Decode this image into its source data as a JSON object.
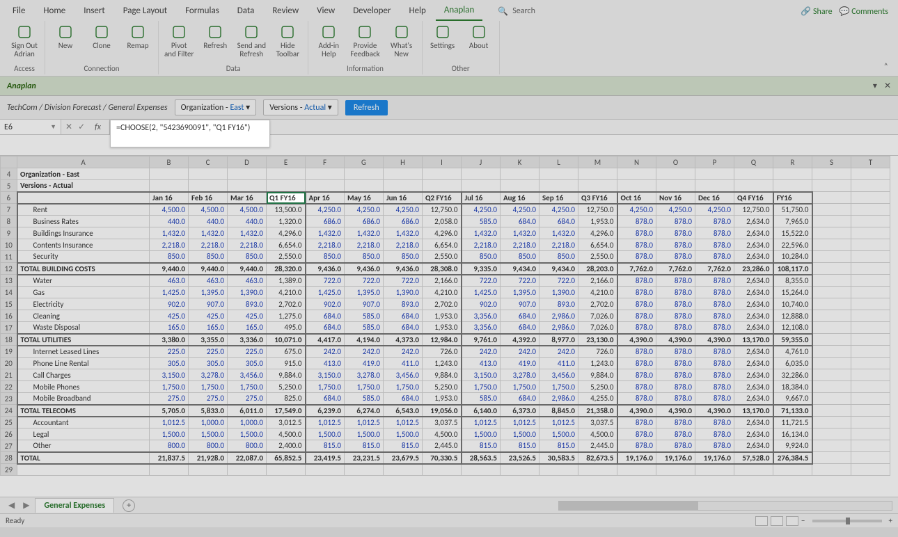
{
  "menu": {
    "items": [
      "File",
      "Home",
      "Insert",
      "Page Layout",
      "Formulas",
      "Data",
      "Review",
      "View",
      "Developer",
      "Help",
      "Anaplan"
    ],
    "active": "Anaplan",
    "search": "Search",
    "share": "Share",
    "comments": "Comments"
  },
  "ribbon": {
    "groups": [
      {
        "title": "Access",
        "items": [
          {
            "label": "Sign Out\nAdrian"
          }
        ]
      },
      {
        "title": "Connection",
        "items": [
          {
            "label": "New"
          },
          {
            "label": "Clone"
          },
          {
            "label": "Remap"
          }
        ]
      },
      {
        "title": "Data",
        "items": [
          {
            "label": "Pivot\nand Filter"
          },
          {
            "label": "Refresh"
          },
          {
            "label": "Send and\nRefresh"
          },
          {
            "label": "Hide\nToolbar"
          }
        ]
      },
      {
        "title": "Information",
        "items": [
          {
            "label": "Add-in\nHelp"
          },
          {
            "label": "Provide\nFeedback"
          },
          {
            "label": "What's\nNew"
          }
        ]
      },
      {
        "title": "Other",
        "items": [
          {
            "label": "Settings"
          },
          {
            "label": "About"
          }
        ]
      }
    ]
  },
  "anaplan_bar": "Anaplan",
  "breadcrumb": "TechCom / Division Forecast / General Expenses",
  "filter1": {
    "label": "Organization - ",
    "value": "East"
  },
  "filter2": {
    "label": "Versions - ",
    "value": "Actual"
  },
  "refresh": "Refresh",
  "namebox": "E6",
  "formula": "=CHOOSE(2, \"5423690091\", \"Q1 FY16\")",
  "col_letters": [
    "A",
    "B",
    "C",
    "D",
    "E",
    "F",
    "G",
    "H",
    "I",
    "J",
    "K",
    "L",
    "M",
    "N",
    "O",
    "P",
    "Q",
    "R",
    "S",
    "T"
  ],
  "row4": "Organization - East",
  "row5": "Versions - Actual",
  "periods": [
    "Jan 16",
    "Feb 16",
    "Mar 16",
    "Q1 FY16",
    "Apr 16",
    "May 16",
    "Jun 16",
    "Q2 FY16",
    "Jul 16",
    "Aug 16",
    "Sep 16",
    "Q3 FY16",
    "Oct 16",
    "Nov 16",
    "Dec 16",
    "Q4 FY16",
    "FY16"
  ],
  "qcols": [
    3,
    7,
    11,
    15,
    16
  ],
  "rows": [
    {
      "n": 7,
      "label": "Rent",
      "indent": true,
      "v": [
        "4,500.0",
        "4,500.0",
        "4,500.0",
        "13,500.0",
        "4,250.0",
        "4,250.0",
        "4,250.0",
        "12,750.0",
        "4,250.0",
        "4,250.0",
        "4,250.0",
        "12,750.0",
        "4,250.0",
        "4,250.0",
        "4,250.0",
        "12,750.0",
        "51,750.0"
      ]
    },
    {
      "n": 8,
      "label": "Business Rates",
      "indent": true,
      "v": [
        "440.0",
        "440.0",
        "440.0",
        "1,320.0",
        "686.0",
        "686.0",
        "686.0",
        "2,058.0",
        "585.0",
        "684.0",
        "684.0",
        "1,953.0",
        "878.0",
        "878.0",
        "878.0",
        "2,634.0",
        "7,965.0"
      ]
    },
    {
      "n": 9,
      "label": "Buildings Insurance",
      "indent": true,
      "v": [
        "1,432.0",
        "1,432.0",
        "1,432.0",
        "4,296.0",
        "1,432.0",
        "1,432.0",
        "1,432.0",
        "4,296.0",
        "1,432.0",
        "1,432.0",
        "1,432.0",
        "4,296.0",
        "878.0",
        "878.0",
        "878.0",
        "2,634.0",
        "15,522.0"
      ]
    },
    {
      "n": 10,
      "label": "Contents Insurance",
      "indent": true,
      "v": [
        "2,218.0",
        "2,218.0",
        "2,218.0",
        "6,654.0",
        "2,218.0",
        "2,218.0",
        "2,218.0",
        "6,654.0",
        "2,218.0",
        "2,218.0",
        "2,218.0",
        "6,654.0",
        "878.0",
        "878.0",
        "878.0",
        "2,634.0",
        "22,596.0"
      ]
    },
    {
      "n": 11,
      "label": "Security",
      "indent": true,
      "v": [
        "850.0",
        "850.0",
        "850.0",
        "2,550.0",
        "850.0",
        "850.0",
        "850.0",
        "2,550.0",
        "850.0",
        "850.0",
        "850.0",
        "2,550.0",
        "878.0",
        "878.0",
        "878.0",
        "2,634.0",
        "10,284.0"
      ]
    },
    {
      "n": 12,
      "label": "TOTAL BUILDING COSTS",
      "total": true,
      "v": [
        "9,440.0",
        "9,440.0",
        "9,440.0",
        "28,320.0",
        "9,436.0",
        "9,436.0",
        "9,436.0",
        "28,308.0",
        "9,335.0",
        "9,434.0",
        "9,434.0",
        "28,203.0",
        "7,762.0",
        "7,762.0",
        "7,762.0",
        "23,286.0",
        "108,117.0"
      ]
    },
    {
      "n": 13,
      "label": "Water",
      "indent": true,
      "v": [
        "463.0",
        "463.0",
        "463.0",
        "1,389.0",
        "722.0",
        "722.0",
        "722.0",
        "2,166.0",
        "722.0",
        "722.0",
        "722.0",
        "2,166.0",
        "878.0",
        "878.0",
        "878.0",
        "2,634.0",
        "8,355.0"
      ]
    },
    {
      "n": 14,
      "label": "Gas",
      "indent": true,
      "v": [
        "1,425.0",
        "1,395.0",
        "1,390.0",
        "4,210.0",
        "1,425.0",
        "1,395.0",
        "1,390.0",
        "4,210.0",
        "1,425.0",
        "1,395.0",
        "1,390.0",
        "4,210.0",
        "878.0",
        "878.0",
        "878.0",
        "2,634.0",
        "15,264.0"
      ]
    },
    {
      "n": 15,
      "label": "Electricity",
      "indent": true,
      "v": [
        "902.0",
        "907.0",
        "893.0",
        "2,702.0",
        "902.0",
        "907.0",
        "893.0",
        "2,702.0",
        "902.0",
        "907.0",
        "893.0",
        "2,702.0",
        "878.0",
        "878.0",
        "878.0",
        "2,634.0",
        "10,740.0"
      ]
    },
    {
      "n": 16,
      "label": "Cleaning",
      "indent": true,
      "v": [
        "425.0",
        "425.0",
        "425.0",
        "1,275.0",
        "684.0",
        "585.0",
        "684.0",
        "1,953.0",
        "3,356.0",
        "684.0",
        "2,986.0",
        "7,026.0",
        "878.0",
        "878.0",
        "878.0",
        "2,634.0",
        "12,888.0"
      ]
    },
    {
      "n": 17,
      "label": "Waste Disposal",
      "indent": true,
      "v": [
        "165.0",
        "165.0",
        "165.0",
        "495.0",
        "684.0",
        "585.0",
        "684.0",
        "1,953.0",
        "3,356.0",
        "684.0",
        "2,986.0",
        "7,026.0",
        "878.0",
        "878.0",
        "878.0",
        "2,634.0",
        "12,108.0"
      ]
    },
    {
      "n": 18,
      "label": "TOTAL UTILITIES",
      "total": true,
      "v": [
        "3,380.0",
        "3,355.0",
        "3,336.0",
        "10,071.0",
        "4,417.0",
        "4,194.0",
        "4,373.0",
        "12,984.0",
        "9,761.0",
        "4,392.0",
        "8,977.0",
        "23,130.0",
        "4,390.0",
        "4,390.0",
        "4,390.0",
        "13,170.0",
        "59,355.0"
      ]
    },
    {
      "n": 19,
      "label": "Internet Leased Lines",
      "indent": true,
      "v": [
        "225.0",
        "225.0",
        "225.0",
        "675.0",
        "242.0",
        "242.0",
        "242.0",
        "726.0",
        "242.0",
        "242.0",
        "242.0",
        "726.0",
        "878.0",
        "878.0",
        "878.0",
        "2,634.0",
        "4,761.0"
      ]
    },
    {
      "n": 20,
      "label": "Phone Line Rental",
      "indent": true,
      "v": [
        "305.0",
        "305.0",
        "305.0",
        "915.0",
        "413.0",
        "419.0",
        "411.0",
        "1,243.0",
        "413.0",
        "419.0",
        "411.0",
        "1,243.0",
        "878.0",
        "878.0",
        "878.0",
        "2,634.0",
        "6,035.0"
      ]
    },
    {
      "n": 21,
      "label": "Call Charges",
      "indent": true,
      "v": [
        "3,150.0",
        "3,278.0",
        "3,456.0",
        "9,884.0",
        "3,150.0",
        "3,278.0",
        "3,456.0",
        "9,884.0",
        "3,150.0",
        "3,278.0",
        "3,456.0",
        "9,884.0",
        "878.0",
        "878.0",
        "878.0",
        "2,634.0",
        "32,286.0"
      ]
    },
    {
      "n": 22,
      "label": "Mobile Phones",
      "indent": true,
      "v": [
        "1,750.0",
        "1,750.0",
        "1,750.0",
        "5,250.0",
        "1,750.0",
        "1,750.0",
        "1,750.0",
        "5,250.0",
        "1,750.0",
        "1,750.0",
        "1,750.0",
        "5,250.0",
        "878.0",
        "878.0",
        "878.0",
        "2,634.0",
        "18,384.0"
      ]
    },
    {
      "n": 23,
      "label": "Mobile Broadband",
      "indent": true,
      "v": [
        "275.0",
        "275.0",
        "275.0",
        "825.0",
        "684.0",
        "585.0",
        "684.0",
        "1,953.0",
        "585.0",
        "684.0",
        "2,986.0",
        "4,255.0",
        "878.0",
        "878.0",
        "878.0",
        "2,634.0",
        "9,667.0"
      ]
    },
    {
      "n": 24,
      "label": "TOTAL TELECOMS",
      "total": true,
      "v": [
        "5,705.0",
        "5,833.0",
        "6,011.0",
        "17,549.0",
        "6,239.0",
        "6,274.0",
        "6,543.0",
        "19,056.0",
        "6,140.0",
        "6,373.0",
        "8,845.0",
        "21,358.0",
        "4,390.0",
        "4,390.0",
        "4,390.0",
        "13,170.0",
        "71,133.0"
      ]
    },
    {
      "n": 25,
      "label": "Accountant",
      "indent": true,
      "v": [
        "1,012.5",
        "1,000.0",
        "1,000.0",
        "3,012.5",
        "1,012.5",
        "1,012.5",
        "1,012.5",
        "3,037.5",
        "1,012.5",
        "1,012.5",
        "1,012.5",
        "3,037.5",
        "878.0",
        "878.0",
        "878.0",
        "2,634.0",
        "11,721.5"
      ]
    },
    {
      "n": 26,
      "label": "Legal",
      "indent": true,
      "v": [
        "1,500.0",
        "1,500.0",
        "1,500.0",
        "4,500.0",
        "1,500.0",
        "1,500.0",
        "1,500.0",
        "4,500.0",
        "1,500.0",
        "1,500.0",
        "1,500.0",
        "4,500.0",
        "878.0",
        "878.0",
        "878.0",
        "2,634.0",
        "16,134.0"
      ]
    },
    {
      "n": 27,
      "label": "Other",
      "indent": true,
      "v": [
        "800.0",
        "800.0",
        "800.0",
        "2,400.0",
        "815.0",
        "815.0",
        "815.0",
        "2,445.0",
        "815.0",
        "815.0",
        "815.0",
        "2,445.0",
        "878.0",
        "878.0",
        "878.0",
        "2,634.0",
        "9,924.0"
      ]
    },
    {
      "n": 28,
      "label": "TOTAL",
      "total": true,
      "grand": true,
      "v": [
        "21,837.5",
        "21,928.0",
        "22,087.0",
        "65,852.5",
        "23,419.5",
        "23,231.5",
        "23,679.5",
        "70,330.5",
        "28,563.5",
        "23,526.5",
        "30,583.5",
        "82,673.5",
        "19,176.0",
        "19,176.0",
        "19,176.0",
        "57,528.0",
        "276,384.5"
      ]
    }
  ],
  "sheet_tab": "General Expenses",
  "status": "Ready"
}
